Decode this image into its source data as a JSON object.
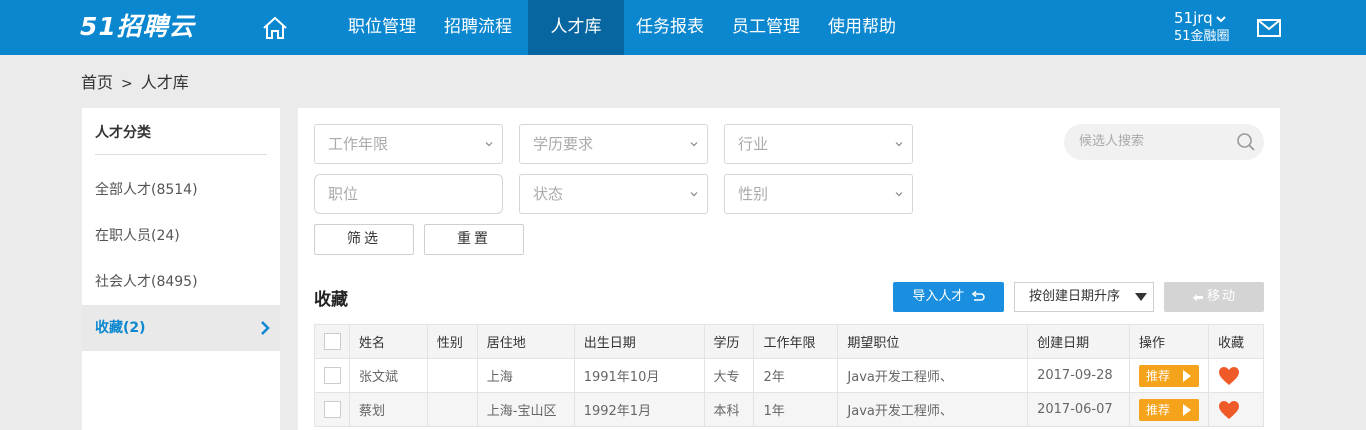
{
  "header": {
    "logo": "51招聘云",
    "nav": [
      "职位管理",
      "招聘流程",
      "人才库",
      "任务报表",
      "员工管理",
      "使用帮助"
    ],
    "active_nav": "人才库",
    "user_name": "51jrq",
    "company": "51金融圈",
    "colors": {
      "bar": "#0b87d0",
      "active": "#07669f"
    }
  },
  "breadcrumb": {
    "home": "首页",
    "separator": ">",
    "current": "人才库"
  },
  "sidebar": {
    "title": "人才分类",
    "items": [
      {
        "label": "全部人才(8514)"
      },
      {
        "label": "在职人员(24)"
      },
      {
        "label": "社会人才(8495)"
      },
      {
        "label": "收藏(2)"
      }
    ]
  },
  "filters": {
    "work_years": "工作年限",
    "education": "学历要求",
    "industry": "行业",
    "position": "职位",
    "status": "状态",
    "gender": "性别",
    "search_placeholder": "候选人搜索",
    "filter_button": "筛选",
    "reset_button": "重置"
  },
  "list": {
    "title": "收藏",
    "import_button": "导入人才",
    "sort_label": "按创建日期升序",
    "move_button": "移动",
    "columns": [
      "姓名",
      "性别",
      "居住地",
      "出生日期",
      "学历",
      "工作年限",
      "期望职位",
      "创建日期",
      "操作",
      "收藏"
    ],
    "rows": [
      {
        "name": "张文斌",
        "gender": "",
        "location": "上海",
        "birth": "1991年10月",
        "edu": "大专",
        "years": "2年",
        "position": "Java开发工程师、",
        "created": "2017-09-28",
        "action": "推荐"
      },
      {
        "name": "蔡划",
        "gender": "",
        "location": "上海-宝山区",
        "birth": "1992年1月",
        "edu": "本科",
        "years": "1年",
        "position": "Java开发工程师、",
        "created": "2017-06-07",
        "action": "推荐"
      }
    ],
    "colors": {
      "recommend": "#f5a31a",
      "heart": "#f05a28",
      "import": "#1a8fe0"
    }
  }
}
